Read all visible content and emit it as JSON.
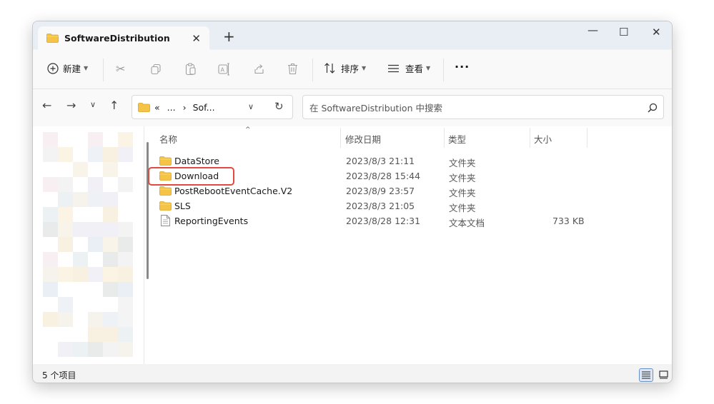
{
  "window": {
    "tab_title": "SoftwareDistribution",
    "tab_close": "✕",
    "new_tab": "+",
    "minimize": "—",
    "maximize": "☐",
    "close": "✕"
  },
  "toolbar": {
    "new_label": "新建",
    "sort_label": "排序",
    "view_label": "查看",
    "more_label": "···",
    "icons": [
      "cut-icon",
      "copy-icon",
      "paste-icon",
      "rename-icon",
      "share-icon",
      "delete-icon"
    ]
  },
  "navbar": {
    "address_overflow": "«",
    "address_ellipsis": "...",
    "address_sep": "›",
    "address_current": "Sof...",
    "search_placeholder": "在 SoftwareDistribution 中搜索"
  },
  "columns": {
    "name": "名称",
    "date": "修改日期",
    "type": "类型",
    "size": "大小"
  },
  "files": [
    {
      "name": "DataStore",
      "date": "2023/8/3 21:11",
      "type": "文件夹",
      "size": "",
      "icon": "folder-icon"
    },
    {
      "name": "Download",
      "date": "2023/8/28 15:44",
      "type": "文件夹",
      "size": "",
      "icon": "folder-icon"
    },
    {
      "name": "PostRebootEventCache.V2",
      "date": "2023/8/9 23:57",
      "type": "文件夹",
      "size": "",
      "icon": "folder-icon"
    },
    {
      "name": "SLS",
      "date": "2023/8/3 21:05",
      "type": "文件夹",
      "size": "",
      "icon": "folder-icon"
    },
    {
      "name": "ReportingEvents",
      "date": "2023/8/28 12:31",
      "type": "文本文档",
      "size": "733 KB",
      "icon": "text-file-icon"
    }
  ],
  "status": {
    "item_count": "5 个项目"
  },
  "colors": {
    "highlight": "#e04a3f",
    "folder": "#f5c447",
    "titlebar": "#e9edf4"
  }
}
